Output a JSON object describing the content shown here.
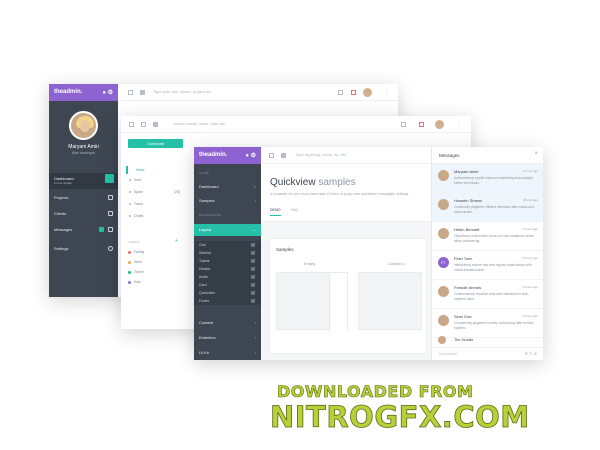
{
  "window1": {
    "brand": "theadmin.",
    "user_name": "Maryam Amiri",
    "user_role": "Web developer",
    "menu": [
      {
        "label": "Dashboard",
        "sub": "5 new update"
      },
      {
        "label": "Projects"
      },
      {
        "label": "Clients"
      },
      {
        "label": "Messages"
      },
      {
        "label": "Settings"
      }
    ],
    "search_placeholder": "Type your site, space, project etc"
  },
  "window2": {
    "compose_label": "Compose",
    "search_placeholder": "Search email, name, date etc",
    "folders": [
      "Inbox",
      "Sent",
      "Spam",
      "Trash",
      "Drafts"
    ],
    "folder_counts": [
      "",
      "",
      "(20)",
      "",
      ""
    ],
    "labels_heading": "LABELS",
    "labels": [
      {
        "label": "Family",
        "color": "#f96868"
      },
      {
        "label": "Work",
        "color": "#f2a654"
      },
      {
        "label": "Travel",
        "color": "#15c377"
      },
      {
        "label": "Kids",
        "color": "#926dde"
      }
    ]
  },
  "window3": {
    "brand": "theadmin.",
    "sidebar": {
      "sec_main": "HOME",
      "dashboard": "Dashboard",
      "samples": "Samples",
      "sec_framework": "FRAMEWORK",
      "layout": "Layout",
      "sub": [
        "Grid",
        "Sidebar",
        "Topbar",
        "Header",
        "Aside",
        "Card",
        "Quickview",
        "Footer"
      ],
      "content": "Content",
      "extention": "Extention",
      "uikit": "UI Kit"
    },
    "search_placeholder": "Type anything, menu, tip, etc",
    "page_title": "Quickview",
    "page_title_light": "samples",
    "page_desc": "A container for your most used data or forms in a pop-over quickview, messages, settings",
    "tabs": [
      "DEMO",
      "FAQ"
    ],
    "card_title": "Samples",
    "col_empty": "Empty",
    "col_contact": "Contact 1",
    "qv": {
      "title": "Messages",
      "close": "×",
      "messages": [
        {
          "name": "Maryam Amiri",
          "time": "23 min ago",
          "text": "Authoritatively exploit resource maximizing technologies before technically."
        },
        {
          "name": "Hossein Shams",
          "time": "48 min ago",
          "text": "Continually plagiarize efficient interfaces after bricks-and-clicks niches."
        },
        {
          "name": "Helen Bennett",
          "time": "2 hours ago",
          "text": "Objectively underwhelm cross-unit web-readiness before sticky outsourcing."
        },
        {
          "name": "Fidel Tonn",
          "time": "3 hours ago",
          "text": "Interactively restore real-time aligned relationships with robust infrastructures.",
          "initials": "FT"
        },
        {
          "name": "Freddie Arends",
          "time": "4 hours ago",
          "text": "Collaboratively visualize corporate initiatives for web-enabled value."
        },
        {
          "name": "Semi Doe",
          "time": "4 hours ago",
          "text": "Competently plagiarize turnkey outsourcing after turnkey systems."
        },
        {
          "name": "Tim Hurdle",
          "time": "",
          "text": ""
        }
      ],
      "footer": "Go to inbox"
    }
  },
  "watermark": {
    "line1": "DOWNLOADED FROM",
    "line2": "NITROGFX.COM"
  },
  "colors": {
    "purple": "#8d63d1",
    "teal": "#26c0a8",
    "sidebar": "#3d4651",
    "watermark": "#b7d13a"
  }
}
